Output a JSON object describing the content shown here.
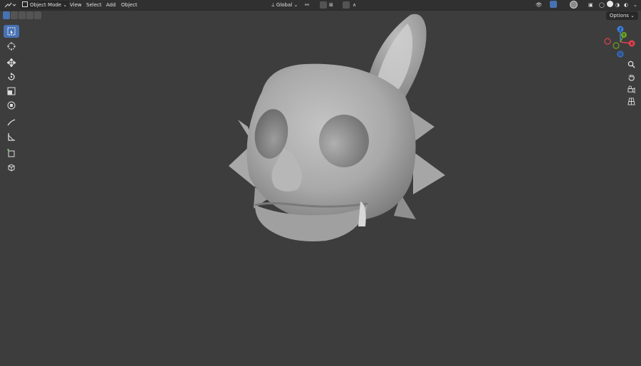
{
  "header": {
    "mode_label": "Object Mode",
    "menus": [
      "View",
      "Select",
      "Add",
      "Object"
    ],
    "orientation_label": "Global"
  },
  "viewport": {
    "options_label": "Options",
    "gizmo_axes": [
      "Z",
      "Y",
      "X"
    ]
  },
  "colors": {
    "background": "#3d3d3d",
    "header": "#303030",
    "accent": "#4772b3",
    "axis_x": "#e0414f",
    "axis_y": "#6ea31d",
    "axis_z": "#3c7ee0"
  },
  "icons": {
    "tools": [
      "select-box-icon",
      "cursor-icon",
      "move-icon",
      "rotate-icon",
      "scale-icon",
      "transform-icon",
      "annotate-icon",
      "measure-icon",
      "add-cube-icon",
      "add-object-icon"
    ],
    "navigation": [
      "zoom-icon",
      "pan-hand-icon",
      "camera-icon",
      "perspective-grid-icon"
    ]
  }
}
